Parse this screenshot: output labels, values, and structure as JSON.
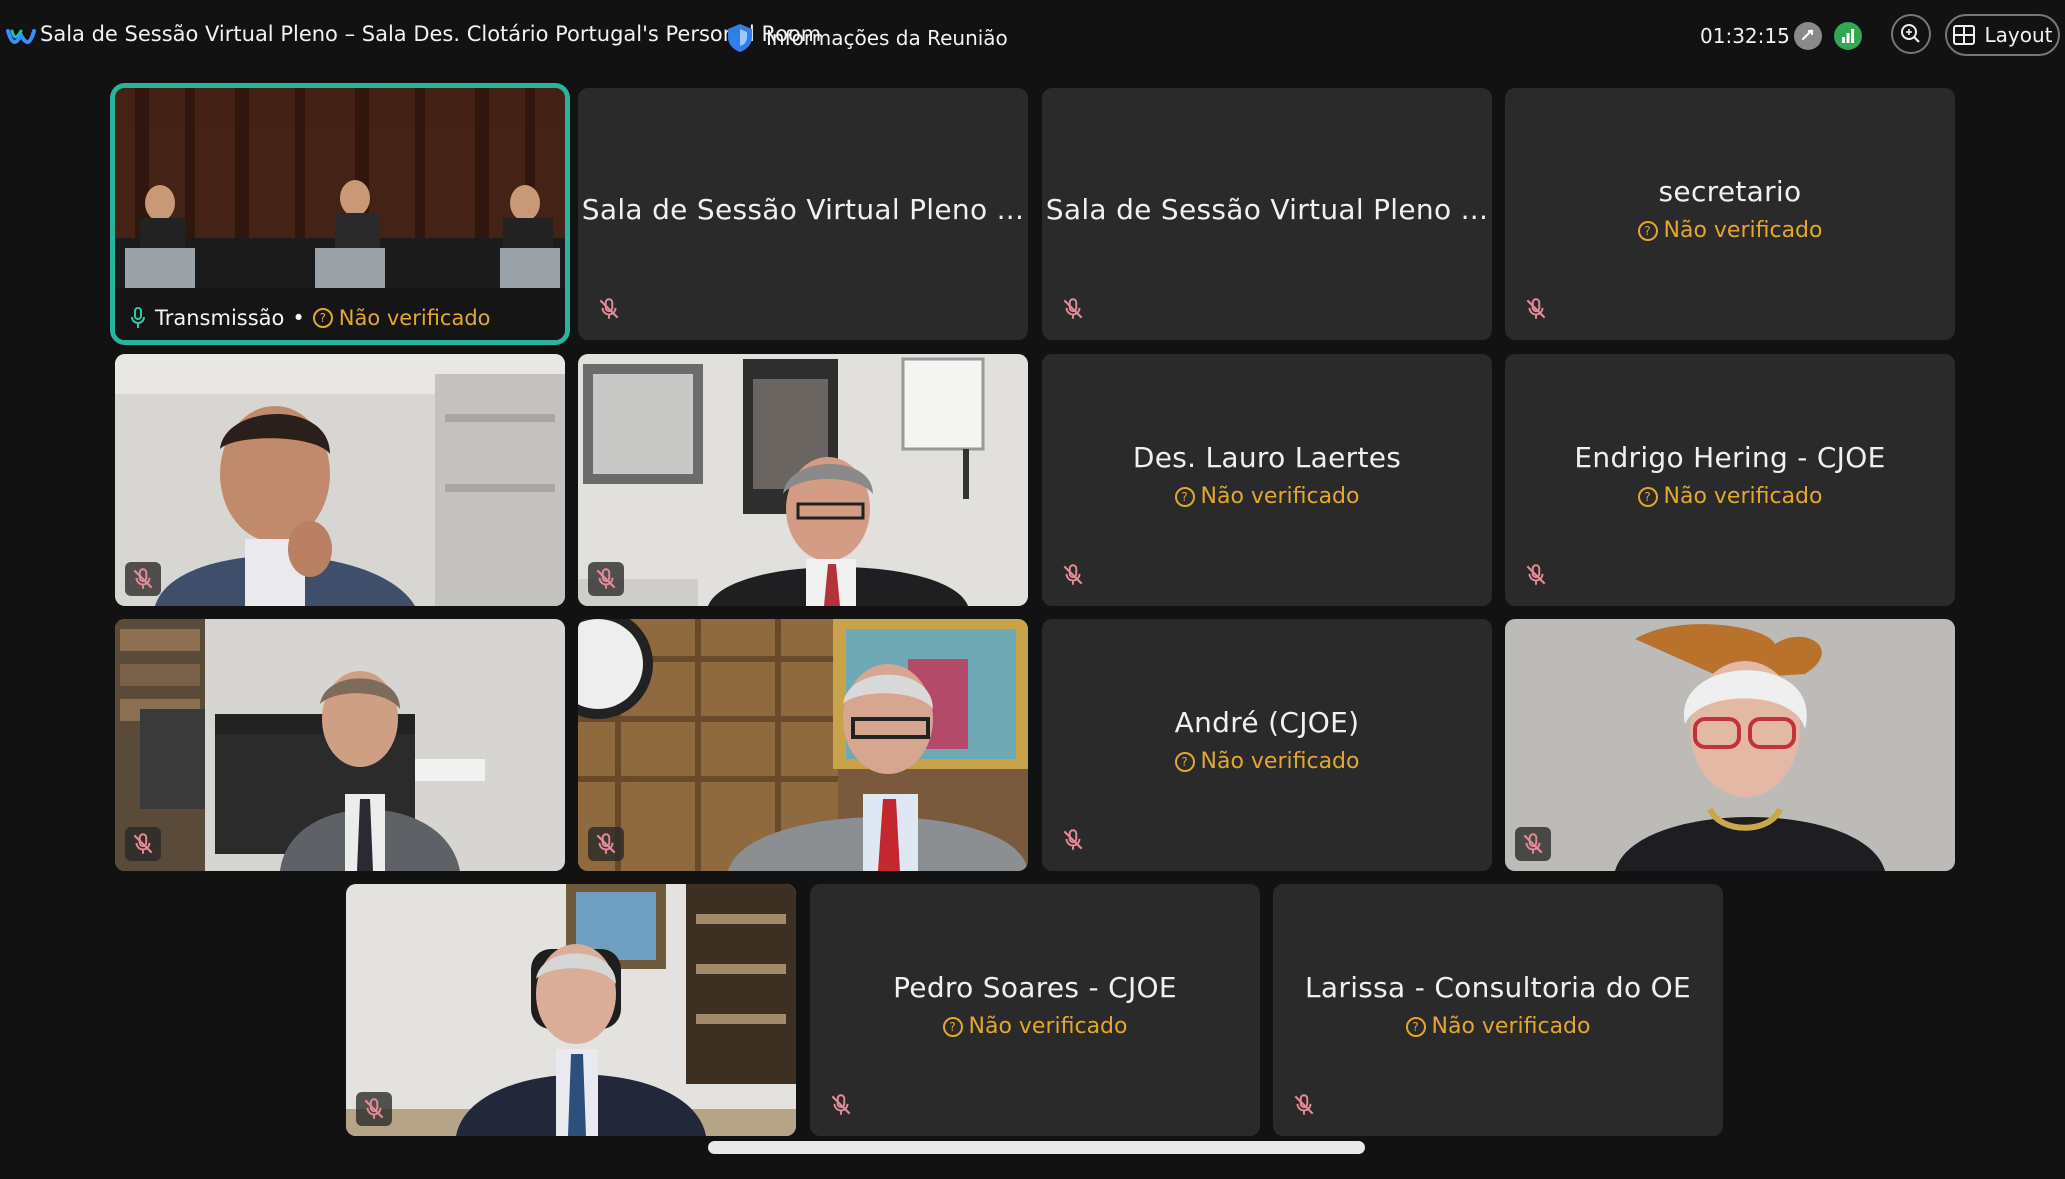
{
  "header": {
    "meeting_title": "Sala de Sessão Virtual Pleno – Sala Des. Clotário Portugal's Personal Room",
    "info_label": "Informações da Reunião",
    "timer": "01:32:15",
    "layout_label": "Layout",
    "icons": [
      "webex-logo",
      "shield-icon",
      "lock-icon",
      "signal-icon",
      "zoom-icon",
      "layout-grid-icon"
    ]
  },
  "tiles": {
    "t1": {
      "name": "Transmissão",
      "status": "Não verificado"
    },
    "t2": {
      "name": "Sala de Sessão Virtual Pleno ..."
    },
    "t3": {
      "name": "Sala de Sessão Virtual Pleno ..."
    },
    "t4": {
      "name": "secretario",
      "status": "Não verificado"
    },
    "t7": {
      "name": "Des. Lauro Laertes",
      "status": "Não verificado"
    },
    "t8": {
      "name": "Endrigo Hering - CJOE",
      "status": "Não verificado"
    },
    "t11": {
      "name": "André (CJOE)",
      "status": "Não verificado"
    },
    "t14": {
      "name": "Pedro Soares - CJOE",
      "status": "Não verificado"
    },
    "t15": {
      "name": "Larissa - Consultoria do OE",
      "status": "Não verificado"
    }
  },
  "colors": {
    "accent_active": "#2ab39c",
    "status_unverified": "#e3a72f",
    "background": "#121212",
    "tile": "#2a2a2a",
    "muted_mic": "#e07b8a"
  }
}
